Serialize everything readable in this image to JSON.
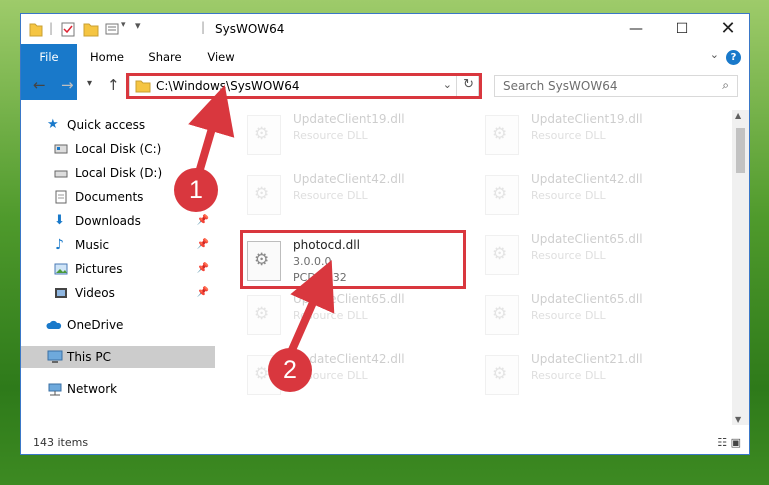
{
  "window": {
    "title": "SysWOW64"
  },
  "tabs": {
    "file": "File",
    "home": "Home",
    "share": "Share",
    "view": "View"
  },
  "address": {
    "path": "C:\\Windows\\SysWOW64"
  },
  "search": {
    "placeholder": "Search SysWOW64"
  },
  "sidebar": {
    "quick_access": "Quick access",
    "items": [
      {
        "label": "Local Disk (C:)"
      },
      {
        "label": "Local Disk (D:)"
      },
      {
        "label": "Documents"
      },
      {
        "label": "Downloads"
      },
      {
        "label": "Music"
      },
      {
        "label": "Pictures"
      },
      {
        "label": "Videos"
      }
    ],
    "onedrive": "OneDrive",
    "this_pc": "This PC",
    "network": "Network"
  },
  "files": [
    {
      "name": "UpdateClient19.dll",
      "type": "Resource DLL"
    },
    {
      "name": "UpdateClient19.dll",
      "type": "Resource DLL"
    },
    {
      "name": "UpdateClient42.dll",
      "type": "Resource DLL"
    },
    {
      "name": "UpdateClient42.dll",
      "type": "Resource DLL"
    },
    {
      "name": "photocd.dll",
      "version": "3.0.0.0",
      "desc": "PCDLIB32"
    },
    {
      "name": "UpdateClient65.dll",
      "type": "Resource DLL"
    },
    {
      "name": "UpdateClient65.dll",
      "type": "Resource DLL"
    },
    {
      "name": "UpdateClient65.dll",
      "type": "Resource DLL"
    },
    {
      "name": "UpdateClient42.dll",
      "type": "Resource DLL"
    },
    {
      "name": "UpdateClient21.dll",
      "type": "Resource DLL"
    }
  ],
  "status": {
    "count": "143 items"
  },
  "annotations": {
    "step1": "1",
    "step2": "2"
  },
  "colors": {
    "accent": "#1979ca",
    "highlight": "#d9373e"
  }
}
